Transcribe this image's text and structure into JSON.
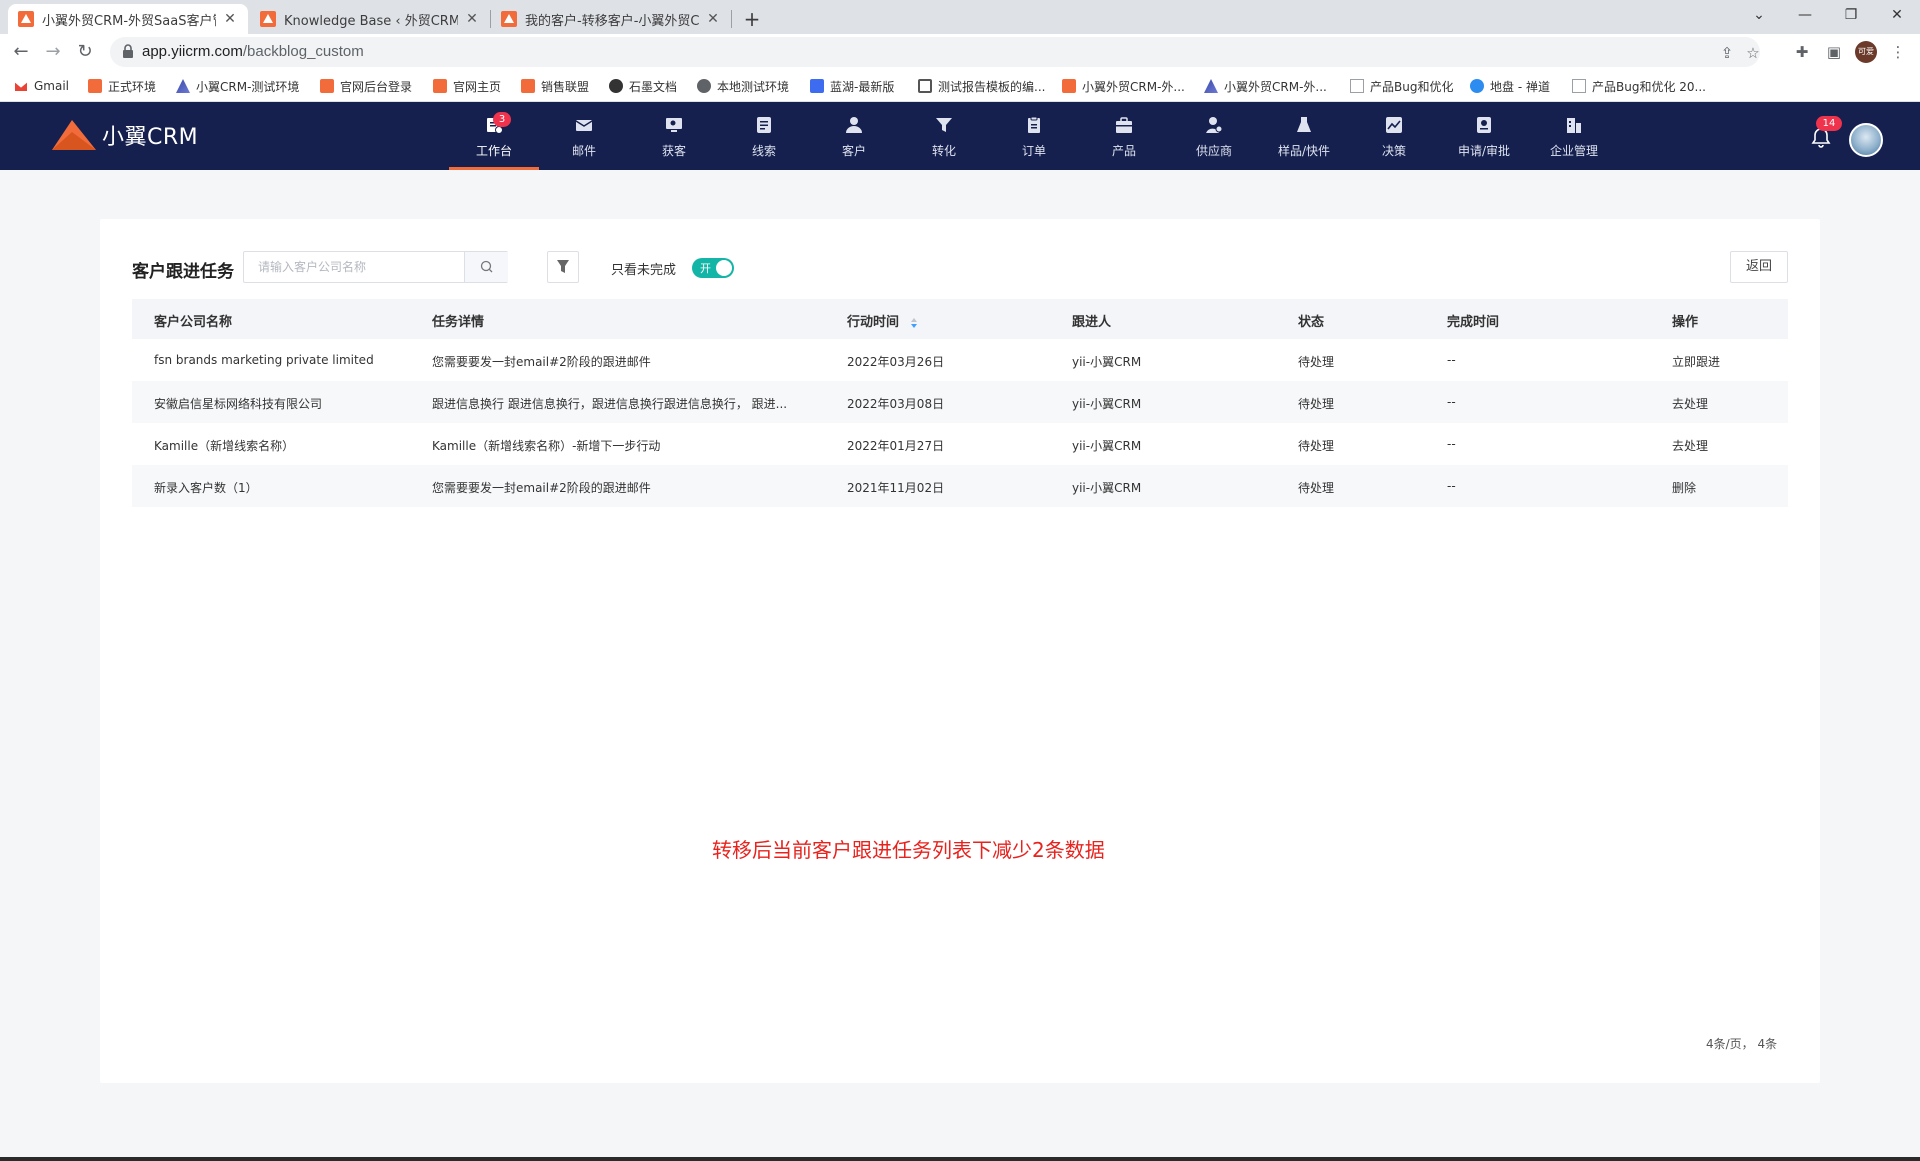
{
  "browser": {
    "tabs": [
      {
        "title": "小翼外贸CRM-外贸SaaS客户管理",
        "active": true
      },
      {
        "title": "Knowledge Base ‹ 外贸CRM-外",
        "active": false
      },
      {
        "title": "我的客户-转移客户-小翼外贸CR",
        "active": false
      }
    ],
    "url_host": "app.yiicrm.com",
    "url_path": "/backblog_custom",
    "profile_label": "可爱",
    "bookmarks": [
      "Gmail",
      "正式环境",
      "小翼CRM-测试环境",
      "官网后台登录",
      "官网主页",
      "销售联盟",
      "石墨文档",
      "本地测试环境",
      "蓝湖-最新版",
      "测试报告模板的编...",
      "小翼外贸CRM-外...",
      "小翼外贸CRM-外...",
      "产品Bug和优化",
      "地盘 - 禅道",
      "产品Bug和优化 20..."
    ]
  },
  "app": {
    "logo_text": "小翼CRM",
    "nav": [
      {
        "label": "工作台",
        "icon": "workbench-icon",
        "badge": "3",
        "active": true
      },
      {
        "label": "邮件",
        "icon": "mail-icon"
      },
      {
        "label": "获客",
        "icon": "acquire-icon"
      },
      {
        "label": "线索",
        "icon": "leads-icon"
      },
      {
        "label": "客户",
        "icon": "customer-icon"
      },
      {
        "label": "转化",
        "icon": "funnel-icon"
      },
      {
        "label": "订单",
        "icon": "order-icon"
      },
      {
        "label": "产品",
        "icon": "product-icon"
      },
      {
        "label": "供应商",
        "icon": "supplier-icon"
      },
      {
        "label": "样品/快件",
        "icon": "sample-icon"
      },
      {
        "label": "决策",
        "icon": "decision-icon"
      },
      {
        "label": "申请/审批",
        "icon": "approval-icon"
      },
      {
        "label": "企业管理",
        "icon": "enterprise-icon"
      }
    ],
    "notification_count": "14",
    "accent_color": "#f26b3a",
    "header_bg": "#15204e"
  },
  "page": {
    "title": "客户跟进任务",
    "search_placeholder": "请输入客户公司名称",
    "toggle_label": "只看未完成",
    "toggle_state": "开",
    "back_label": "返回",
    "columns": [
      "客户公司名称",
      "任务详情",
      "行动时间",
      "跟进人",
      "状态",
      "完成时间",
      "操作"
    ],
    "rows": [
      {
        "company": "fsn brands marketing private limited",
        "detail": "您需要要发一封email#2阶段的跟进邮件",
        "time": "2022年03月26日",
        "owner": "yii-小翼CRM",
        "status": "待处理",
        "done": "--",
        "action": "立即跟进"
      },
      {
        "company": "安徽启信星标网络科技有限公司",
        "detail": "跟进信息换行 跟进信息换行，跟进信息换行跟进信息换行， 跟进...",
        "time": "2022年03月08日",
        "owner": "yii-小翼CRM",
        "status": "待处理",
        "done": "--",
        "action": "去处理"
      },
      {
        "company": "Kamille（新增线索名称）",
        "detail": "Kamille（新增线索名称）-新增下一步行动",
        "time": "2022年01月27日",
        "owner": "yii-小翼CRM",
        "status": "待处理",
        "done": "--",
        "action": "去处理"
      },
      {
        "company": "新录入客户数（1）",
        "detail": "您需要要发一封email#2阶段的跟进邮件",
        "time": "2021年11月02日",
        "owner": "yii-小翼CRM",
        "status": "待处理",
        "done": "--",
        "action": "删除"
      }
    ],
    "annotation": "转移后当前客户跟进任务列表下减少2条数据",
    "pagination": "4条/页， 4条"
  }
}
